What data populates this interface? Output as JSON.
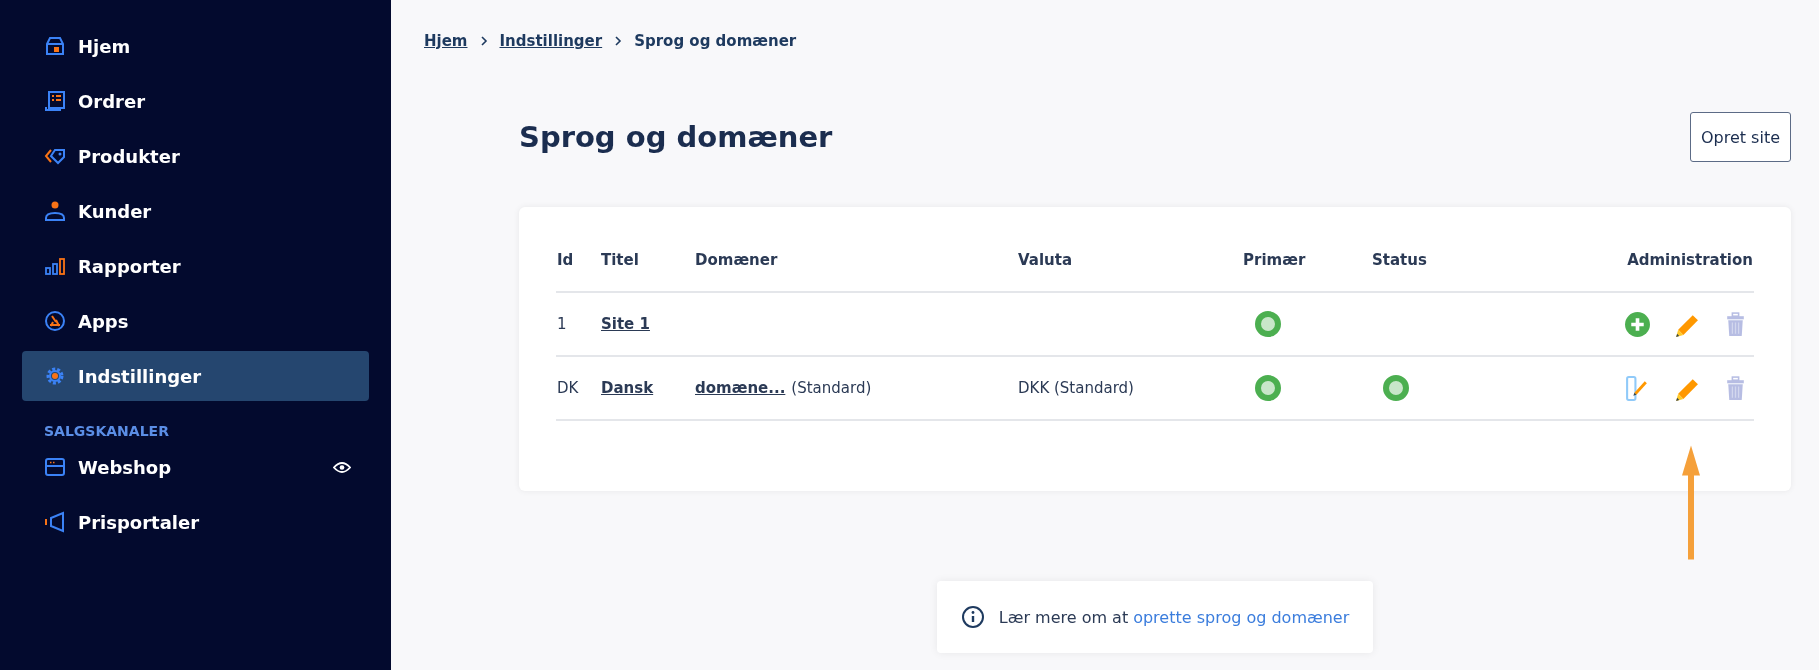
{
  "sidebar": {
    "items": [
      {
        "label": "Hjem",
        "selected": false
      },
      {
        "label": "Ordrer",
        "selected": false
      },
      {
        "label": "Produkter",
        "selected": false
      },
      {
        "label": "Kunder",
        "selected": false
      },
      {
        "label": "Rapporter",
        "selected": false
      },
      {
        "label": "Apps",
        "selected": false
      },
      {
        "label": "Indstillinger",
        "selected": true
      }
    ],
    "section_title": "SALGSKANALER",
    "channels": [
      {
        "label": "Webshop",
        "visible": true
      },
      {
        "label": "Prisportaler",
        "visible": false
      }
    ]
  },
  "breadcrumb": {
    "links": [
      "Hjem",
      "Indstillinger"
    ],
    "current": "Sprog og domæner"
  },
  "page_title": "Sprog og domæner",
  "create_button": "Opret site",
  "table": {
    "columns": [
      "Id",
      "Titel",
      "Domæner",
      "Valuta",
      "Primær",
      "Status",
      "Administration"
    ],
    "rows": [
      {
        "id": "1",
        "title": "Site 1",
        "domain": "",
        "domain_note": "",
        "currency": "",
        "primary": true,
        "status": false,
        "actions": [
          {
            "kind": "add",
            "disabled": false
          },
          {
            "kind": "edit",
            "disabled": false
          },
          {
            "kind": "delete",
            "disabled": true
          }
        ]
      },
      {
        "id": "DK",
        "title": "Dansk",
        "domain": "domæne...",
        "domain_note": "(Standard)",
        "currency": "DKK (Standard)",
        "primary": true,
        "status": true,
        "actions": [
          {
            "kind": "edit-page",
            "disabled": false
          },
          {
            "kind": "edit",
            "disabled": false
          },
          {
            "kind": "delete",
            "disabled": true
          }
        ]
      }
    ]
  },
  "info": {
    "text": "Lær mere om at",
    "link": "oprette sprog og domæner"
  }
}
